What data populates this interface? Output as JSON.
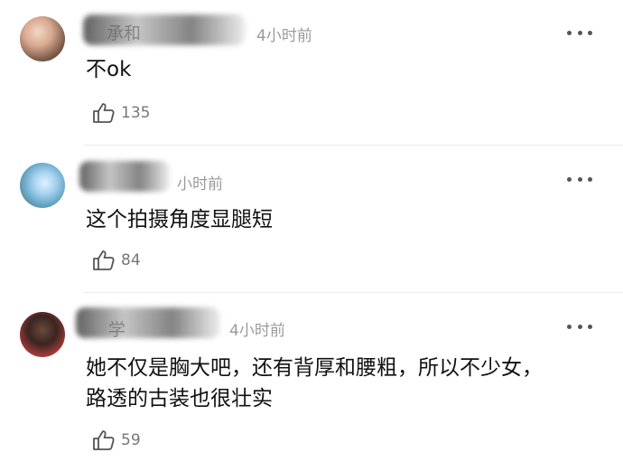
{
  "comments": [
    {
      "name": "承和",
      "time": "4小时前",
      "text": "不ok",
      "likes": "135"
    },
    {
      "name": "",
      "time": "小时前",
      "text": "这个拍摄角度显腿短",
      "likes": "84"
    },
    {
      "name": "学",
      "time": "4小时前",
      "text_line1": "她不仅是胸大吧，还有背厚和腰粗，所以不少女，",
      "text_line2": "路透的古装也很壮实",
      "likes": "59"
    }
  ],
  "icons": {
    "like": "thumbs-up-icon",
    "more": "more-dots-icon"
  }
}
